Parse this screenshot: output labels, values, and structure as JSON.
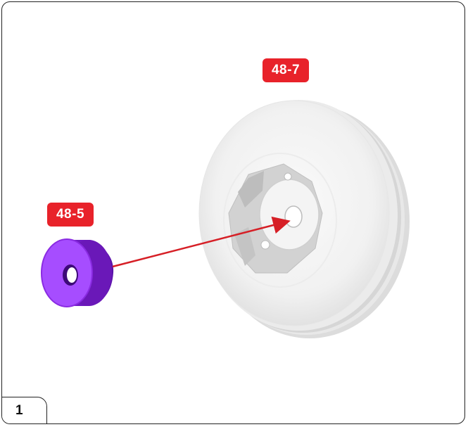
{
  "step": {
    "number": "1"
  },
  "parts": {
    "wheel_label": "48-7",
    "spacer_label": "48-5"
  },
  "colors": {
    "label_bg": "#e8222a",
    "spacer": "#8a2be2",
    "arrow": "#d61f26",
    "wheel": "#f2f2f2"
  },
  "icons": {
    "wheel": "pulley-wheel-part-icon",
    "spacer": "purple-spacer-bushing-icon",
    "arrow": "assembly-direction-arrow"
  }
}
